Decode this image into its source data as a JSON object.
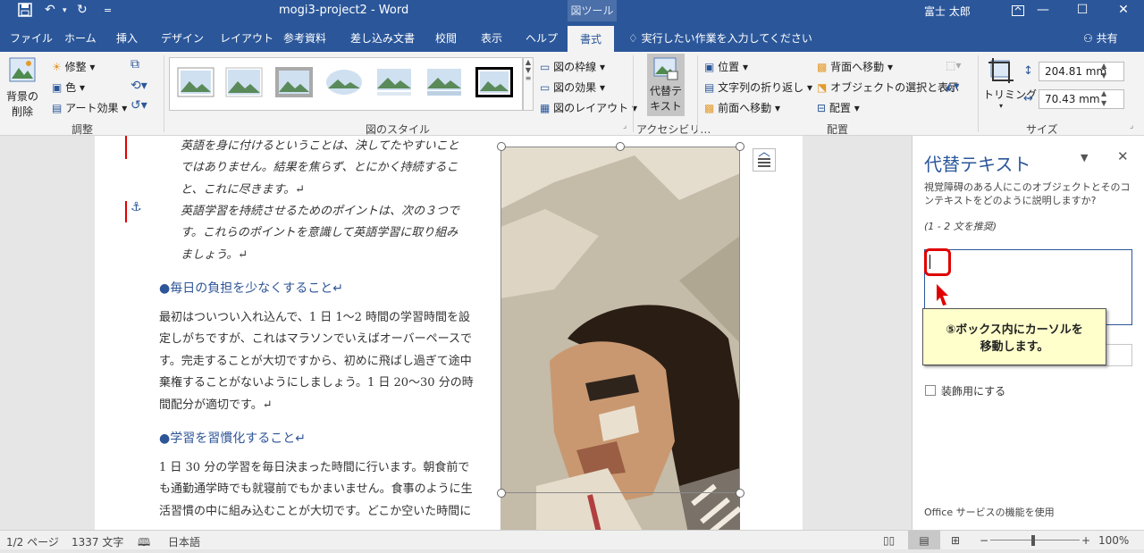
{
  "titlebar": {
    "document_title": "mogi3-project2 - Word",
    "context_tab": "図ツール",
    "user": "富士 太郎",
    "qa_dropdown": "="
  },
  "tabs": [
    "ファイル",
    "ホーム",
    "挿入",
    "デザイン",
    "レイアウト",
    "参考資料",
    "差し込み文書",
    "校閲",
    "表示",
    "ヘルプ",
    "書式"
  ],
  "tell_me": "実行したい作業を入力してください",
  "share": "共有",
  "ribbon": {
    "remove_bg": [
      "背景の",
      "削除"
    ],
    "corrections": "修整",
    "color": "色",
    "artistic": "アート効果",
    "group_adjust": "調整",
    "border": "図の枠線",
    "effects": "図の効果",
    "layout": "図のレイアウト",
    "group_styles": "図のスタイル",
    "alt_text": [
      "代替テ",
      "キスト"
    ],
    "group_access": "アクセシビリ…",
    "position": "位置",
    "wrap": "文字列の折り返し",
    "forward": "前面へ移動",
    "backward": "背面へ移動",
    "selection_pane": "オブジェクトの選択と表示",
    "align": "配置",
    "group_arrange": "配置",
    "crop": "トリミング",
    "height": "204.81 mm",
    "width": "70.43 mm",
    "group_size": "サイズ"
  },
  "document": {
    "p1": [
      "英語を身に付けるということは、決してたやすいこと",
      "ではありません。結果を焦らず、とにかく持続するこ",
      "と、これに尽きます。↵"
    ],
    "p2": [
      "英語学習を持続させるためのポイントは、次の３つで",
      "す。これらのポイントを意識して英語学習に取り組み",
      "ましょう。↵"
    ],
    "h1": "●毎日の負担を少なくすること↵",
    "p3": [
      "最初はついつい入れ込んで、1 日 1～2 時間の学習時間を設",
      "定しがちですが、これはマラソンでいえばオーバーペースで",
      "す。完走することが大切ですから、初めに飛ばし過ぎて途中",
      "棄権することがないようにしましょう。1 日 20～30 分の時",
      "間配分が適切です。↵"
    ],
    "h2": "●学習を習慣化すること↵",
    "p4": [
      "1 日 30 分の学習を毎日決まった時間に行います。朝食前で",
      "も通勤通学時でも就寝前でもかまいません。食事のように生",
      "活習慣の中に組み込むことが大切です。どこか空いた時間に"
    ]
  },
  "pane": {
    "title": "代替テキスト",
    "description": "視覚障碍のある人にこのオブジェクトとそのコンテキストをどのように説明しますか?",
    "hint": "(1 - 2 文を推奨)",
    "decorative": "装飾用にする",
    "footer": "Office サービスの機能を使用"
  },
  "callout": {
    "text_line1": "⑤ボックス内にカーソルを",
    "text_line2": "移動します。"
  },
  "status": {
    "page": "1/2 ページ",
    "words": "1337 文字",
    "lang": "日本語",
    "zoom": "100%"
  },
  "colors": {
    "accent": "#2b579a",
    "callout_bg": "#ffffcc",
    "highlight": "#e00000"
  }
}
